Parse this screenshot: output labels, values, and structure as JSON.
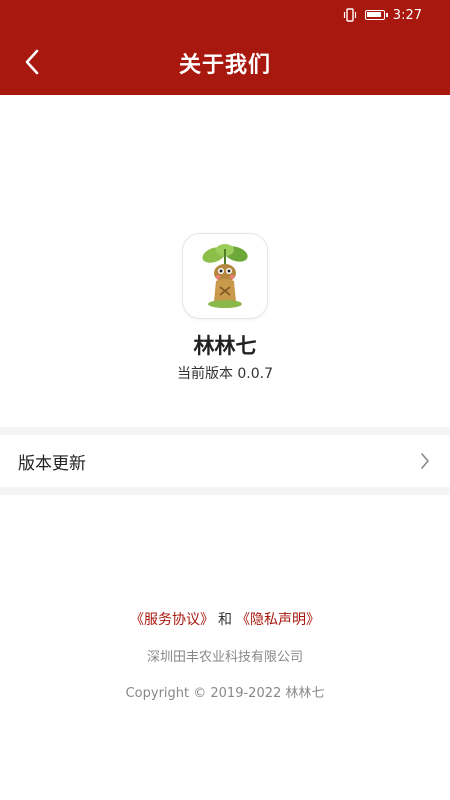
{
  "status_bar": {
    "time": "3:27"
  },
  "header": {
    "title": "关于我们"
  },
  "app": {
    "name": "林林七",
    "version_label": "当前版本 0.0.7"
  },
  "settings": {
    "update_label": "版本更新"
  },
  "footer": {
    "service_agreement": "《服务协议》",
    "and": "和",
    "privacy_statement": "《隐私声明》",
    "company": "深圳田丰农业科技有限公司",
    "copyright": "Copyright © 2019-2022 林林七"
  },
  "colors": {
    "brand": "#a8180f",
    "divider": "#f4f4f4",
    "muted_text": "#888888"
  },
  "icons": [
    "back-arrow-icon",
    "vibrate-icon",
    "battery-icon",
    "app-logo-icon",
    "chevron-right-icon"
  ]
}
